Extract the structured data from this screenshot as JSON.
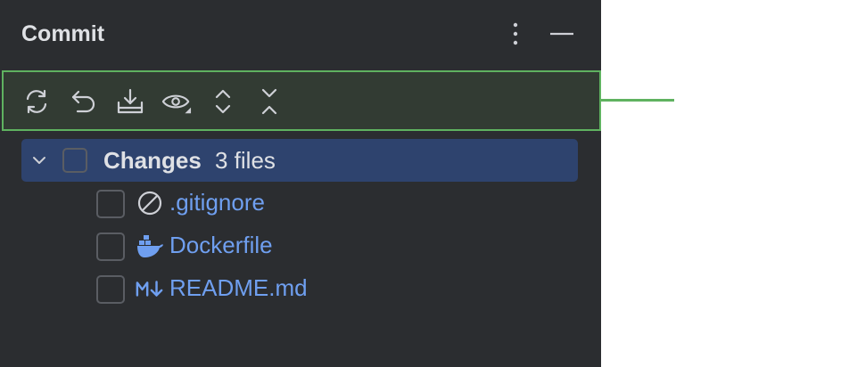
{
  "window": {
    "title": "Commit"
  },
  "header": {
    "more_icon": "more-vertical-icon",
    "minimize_icon": "minimize-icon"
  },
  "toolbar": {
    "icons": [
      "refresh-icon",
      "rollback-icon",
      "shelve-icon",
      "view-options-icon",
      "expand-all-icon",
      "collapse-all-icon"
    ]
  },
  "changes": {
    "group_label": "Changes",
    "group_count": "3 files",
    "files": [
      {
        "name": ".gitignore",
        "icon": "ignore-icon"
      },
      {
        "name": "Dockerfile",
        "icon": "docker-icon"
      },
      {
        "name": "README.md",
        "icon": "markdown-icon"
      }
    ]
  },
  "colors": {
    "panel_bg": "#2b2d30",
    "highlight_border": "#5fb260",
    "selected_row": "#2e436e",
    "file_text": "#6f9ff0"
  }
}
